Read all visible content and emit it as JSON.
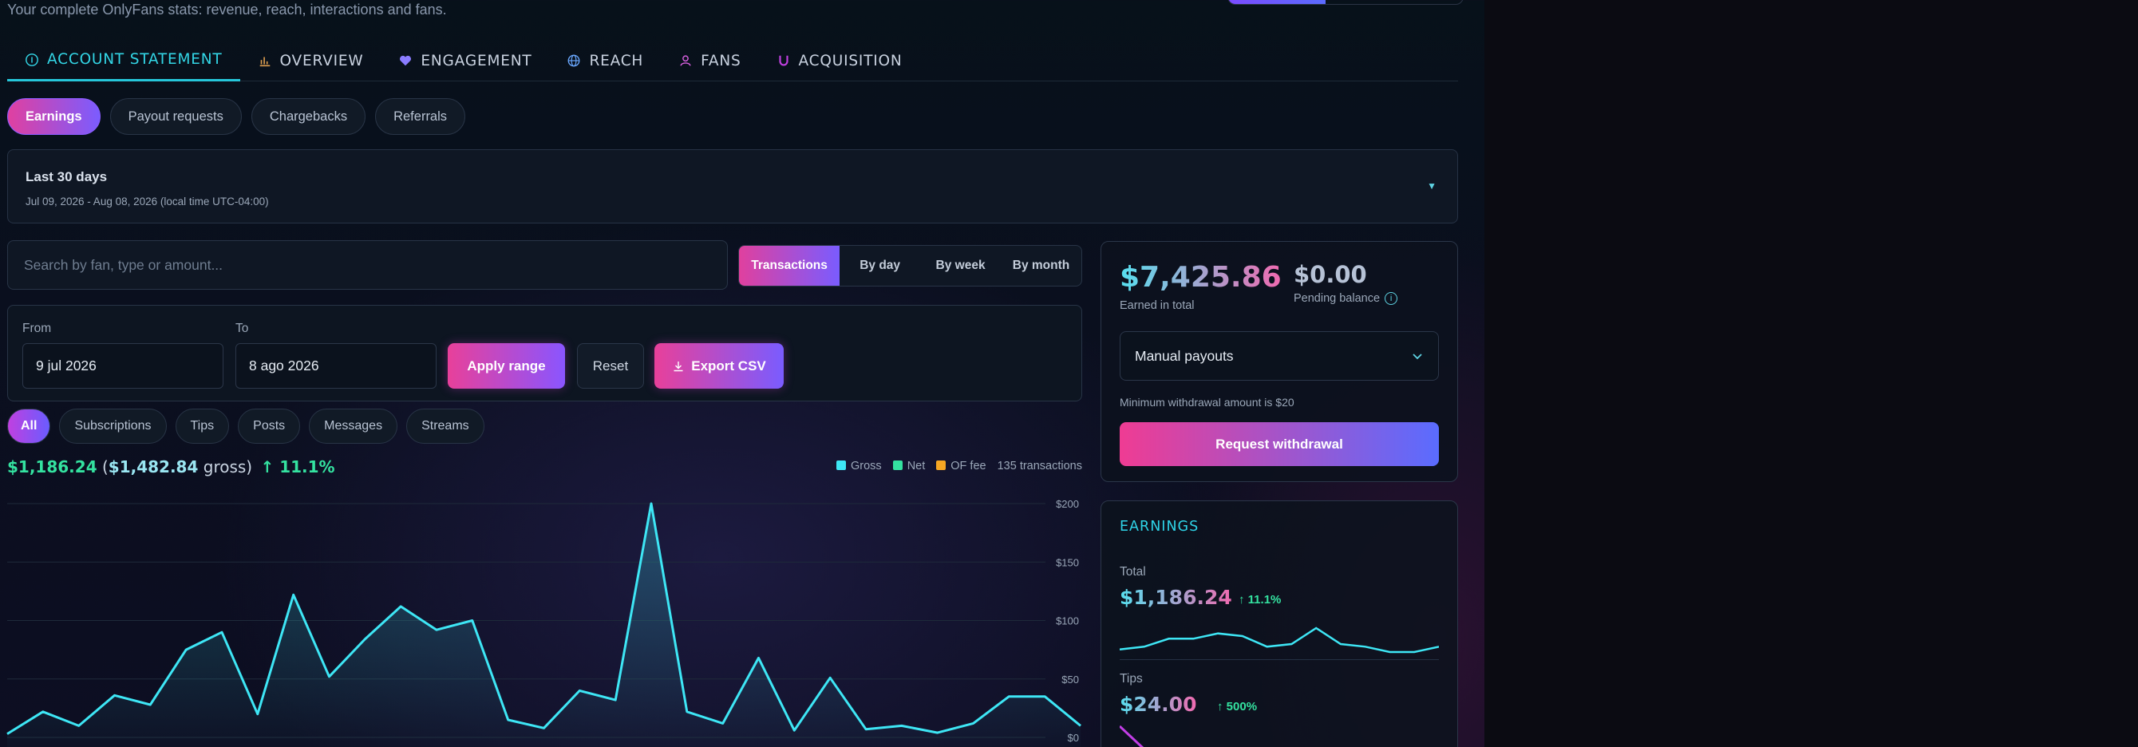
{
  "header": {
    "subtitle": "Your complete OnlyFans stats: revenue, reach, interactions and fans."
  },
  "tabs": [
    {
      "label": "ACCOUNT STATEMENT",
      "icon": "info-circle-icon",
      "active": true
    },
    {
      "label": "OVERVIEW",
      "icon": "bar-chart-icon"
    },
    {
      "label": "ENGAGEMENT",
      "icon": "heart-icon"
    },
    {
      "label": "REACH",
      "icon": "globe-icon"
    },
    {
      "label": "FANS",
      "icon": "user-icon"
    },
    {
      "label": "ACQUISITION",
      "icon": "magnet-icon"
    }
  ],
  "subtabs": [
    "Earnings",
    "Payout requests",
    "Chargebacks",
    "Referrals"
  ],
  "range": {
    "title": "Last 30 days",
    "detail": "Jul 09, 2026 - Aug 08, 2026 (local time UTC-04:00)"
  },
  "search": {
    "placeholder": "Search by fan, type or amount..."
  },
  "view_modes": [
    "Transactions",
    "By day",
    "By week",
    "By month"
  ],
  "filters": {
    "from_label": "From",
    "from_value": "9 jul 2026",
    "to_label": "To",
    "to_value": "8 ago 2026",
    "apply": "Apply range",
    "reset": "Reset",
    "export": "Export CSV"
  },
  "types": [
    "All",
    "Subscriptions",
    "Tips",
    "Posts",
    "Messages",
    "Streams"
  ],
  "summary": {
    "net": "$1,186.24",
    "open": "(",
    "gross": "$1,482.84",
    "gross_suffix": "gross)",
    "pct": "↑ 11.1%"
  },
  "legend": {
    "gross": "Gross",
    "net": "Net",
    "fee": "OF fee",
    "count": "135 transactions"
  },
  "colors": {
    "gross": "#3ee6f5",
    "net": "#34e2a0",
    "fee": "#f5a623",
    "accent": "#26c6da"
  },
  "chart_data": {
    "type": "line",
    "y_ticks": [
      "$200",
      "$150",
      "$100",
      "$50",
      "$0"
    ],
    "ylim": [
      0,
      200
    ],
    "series": [
      {
        "name": "Gross",
        "values": [
          3,
          22,
          10,
          36,
          28,
          75,
          90,
          20,
          122,
          52,
          84,
          112,
          92,
          100,
          15,
          8,
          40,
          32,
          200,
          22,
          12,
          68,
          6,
          51,
          7,
          10,
          4,
          12,
          35,
          35,
          10
        ]
      }
    ]
  },
  "balance": {
    "earned": "$7,425.86",
    "earned_label": "Earned in total",
    "pending": "$0.00",
    "pending_label": "Pending balance",
    "payout_method": "Manual payouts",
    "min_note": "Minimum withdrawal amount is $20",
    "request": "Request withdrawal"
  },
  "earnings": {
    "title": "EARNINGS",
    "total_label": "Total",
    "total_value": "$1,186.24",
    "total_pct": "↑ 11.1%",
    "total_spark": [
      2,
      3,
      6,
      6,
      8,
      7,
      3,
      4,
      10,
      4,
      3,
      1,
      1,
      3
    ],
    "tips_label": "Tips",
    "tips_value": "$24.00",
    "tips_pct": "↑ 500%"
  }
}
